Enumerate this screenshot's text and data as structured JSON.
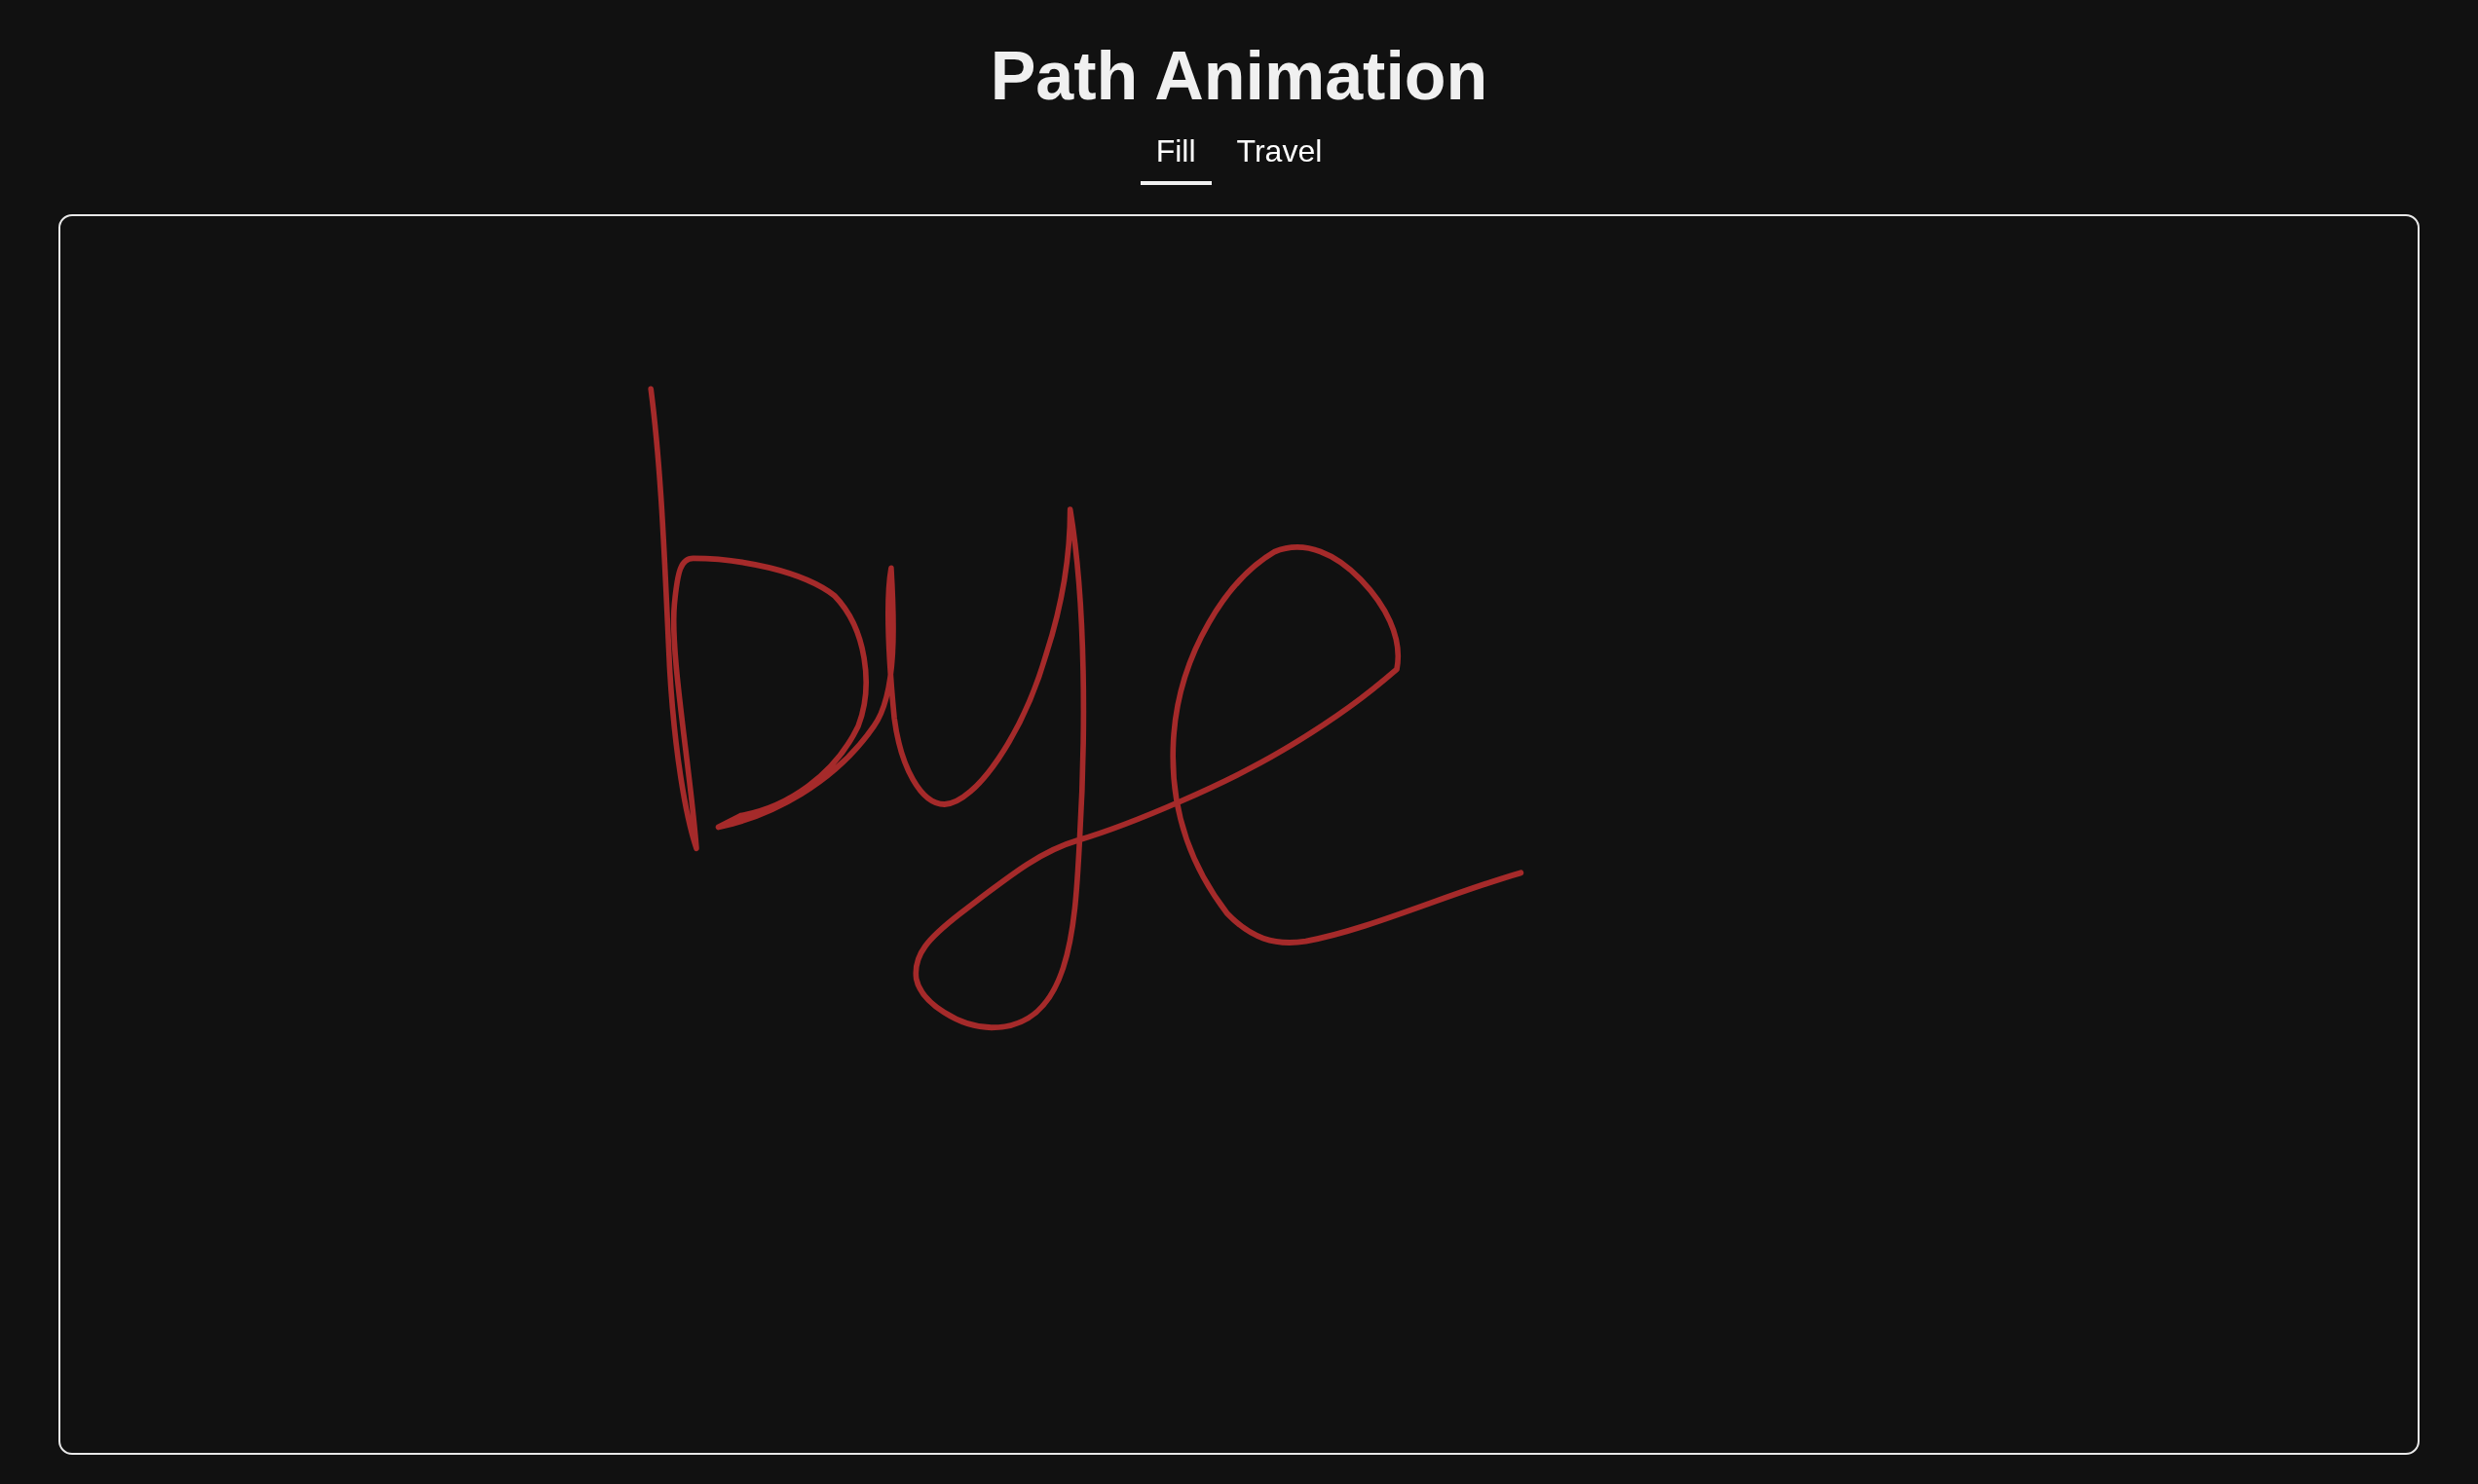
{
  "title": "Path Animation",
  "tabs": [
    {
      "label": "Fill",
      "selected": true
    },
    {
      "label": "Travel",
      "selected": false
    }
  ]
}
